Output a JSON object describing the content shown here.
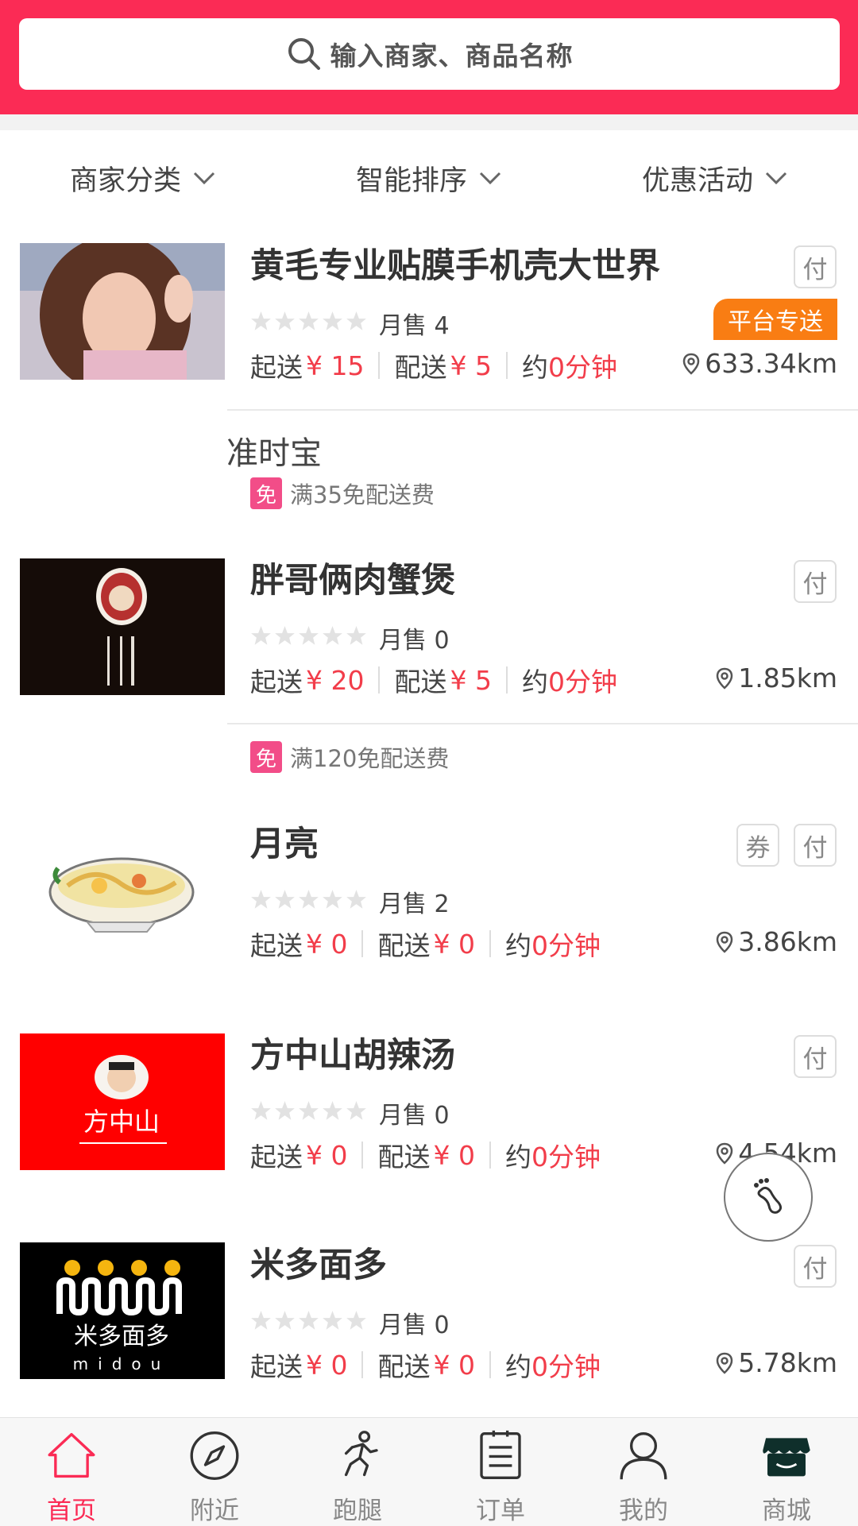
{
  "search": {
    "placeholder": "输入商家、商品名称"
  },
  "filters": [
    {
      "label": "商家分类"
    },
    {
      "label": "智能排序"
    },
    {
      "label": "优惠活动"
    }
  ],
  "shops": [
    {
      "name": "黄毛专业贴膜手机壳大世界",
      "sales": "月售 4",
      "start_label": "起送",
      "start_price": "¥ 15",
      "delivery_label": "配送",
      "delivery_price": "¥ 5",
      "time_prefix": "约",
      "time_value": "0分钟",
      "distance": "633.34km",
      "tags": [
        "付"
      ],
      "badge": "平台专送",
      "extra": "准时宝",
      "promo_icon": "免",
      "promo": "满35免配送费"
    },
    {
      "name": "胖哥俩肉蟹煲",
      "sales": "月售 0",
      "start_label": "起送",
      "start_price": "¥ 20",
      "delivery_label": "配送",
      "delivery_price": "¥ 5",
      "time_prefix": "约",
      "time_value": "0分钟",
      "distance": "1.85km",
      "tags": [
        "付"
      ],
      "promo_icon": "免",
      "promo": "满120免配送费"
    },
    {
      "name": "月亮",
      "sales": "月售 2",
      "start_label": "起送",
      "start_price": "¥ 0",
      "delivery_label": "配送",
      "delivery_price": "¥ 0",
      "time_prefix": "约",
      "time_value": "0分钟",
      "distance": "3.86km",
      "tags": [
        "券",
        "付"
      ]
    },
    {
      "name": "方中山胡辣汤",
      "sales": "月售 0",
      "start_label": "起送",
      "start_price": "¥ 0",
      "delivery_label": "配送",
      "delivery_price": "¥ 0",
      "time_prefix": "约",
      "time_value": "0分钟",
      "distance": "4.54km",
      "tags": [
        "付"
      ],
      "logo_text": "方中山"
    },
    {
      "name": "米多面多",
      "sales": "月售 0",
      "start_label": "起送",
      "start_price": "¥ 0",
      "delivery_label": "配送",
      "delivery_price": "¥ 0",
      "time_prefix": "约",
      "time_value": "0分钟",
      "distance": "5.78km",
      "tags": [
        "付"
      ],
      "logo_text": "米多面多",
      "logo_sub": "midou"
    }
  ],
  "tabbar": [
    {
      "label": "首页",
      "icon": "home-icon",
      "active": true
    },
    {
      "label": "附近",
      "icon": "compass-icon"
    },
    {
      "label": "跑腿",
      "icon": "runner-icon"
    },
    {
      "label": "订单",
      "icon": "order-icon"
    },
    {
      "label": "我的",
      "icon": "user-icon"
    },
    {
      "label": "商城",
      "icon": "store-icon"
    }
  ],
  "colors": {
    "brand": "#fb2b55",
    "price": "#f23d4a",
    "badge": "#f97d13",
    "promo": "#f24d88"
  }
}
